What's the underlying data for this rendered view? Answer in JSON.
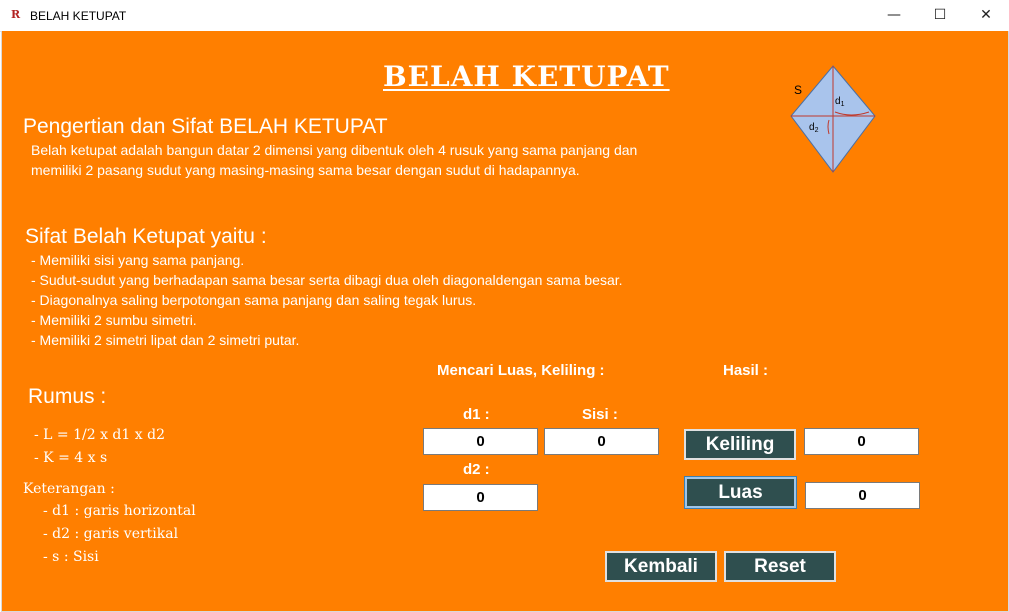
{
  "window": {
    "title": "BELAH KETUPAT",
    "app_icon": "R",
    "minimize": "—",
    "maximize": "☐",
    "close": "✕"
  },
  "main": {
    "title": "BELAH KETUPAT",
    "definition_heading": "Pengertian dan Sifat BELAH KETUPAT",
    "definition_text": "Belah ketupat adalah bangun datar 2 dimensi yang dibentuk oleh 4 rusuk yang sama panjang dan memiliki 2 pasang sudut yang masing-masing sama besar dengan sudut di hadapannya.",
    "properties_heading": "Sifat Belah Ketupat yaitu :",
    "properties": [
      "- Memiliki sisi yang sama panjang.",
      "- Sudut-sudut yang berhadapan sama besar serta dibagi dua oleh diagonaldengan sama besar.",
      "- Diagonalnya saling berpotongan sama panjang dan saling tegak lurus.",
      "- Memiliki 2 sumbu simetri.",
      "- Memiliki 2 simetri lipat dan 2 simetri putar."
    ]
  },
  "diagram": {
    "s_label": "S",
    "d1_label": "d",
    "d1_sub": "1",
    "d2_label": "d",
    "d2_sub": "2"
  },
  "formula": {
    "heading": "Rumus :",
    "luas": "- L = 1/2  x  d1  x  d2",
    "keliling": "- K = 4   x   s",
    "keterangan": "Keterangan :",
    "items": [
      "- d1 : garis horizontal",
      "- d2 : garis vertikal",
      "- s    : Sisi"
    ]
  },
  "calculator": {
    "heading": "Mencari Luas, Keliling :",
    "result_heading": "Hasil   :",
    "d1_label": "d1 :",
    "sisi_label": "Sisi :",
    "d2_label": "d2 :",
    "d1_value": "0",
    "sisi_value": "0",
    "d2_value": "0",
    "keliling_button": "Keliling",
    "luas_button": "Luas",
    "keliling_result": "0",
    "luas_result": "0",
    "kembali_button": "Kembali",
    "reset_button": "Reset"
  },
  "colors": {
    "background": "#ff7f00",
    "button": "#2f4f4f",
    "diagram_fill": "#a9c4ec",
    "diagram_line": "#c0392b"
  }
}
